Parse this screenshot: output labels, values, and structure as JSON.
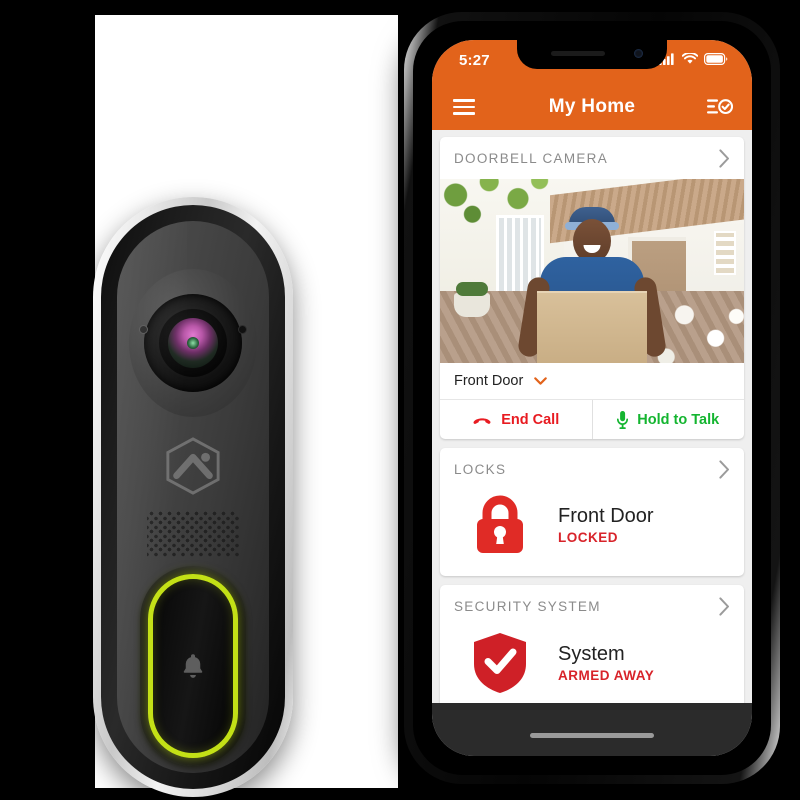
{
  "scene": {
    "background_color": "#000000",
    "panel_color": "#ffffff"
  },
  "doorbell_device": {
    "name": "video-doorbell",
    "brand_logo": "alarm-dot-com-hexagon-logo",
    "button_glyph": "bell-icon",
    "ring_light_color": "#c3e016",
    "body_color": "#3b3b3b",
    "trim_color": "#d8d8d8"
  },
  "phone": {
    "frame_color": "#0a0a0a",
    "status_bar": {
      "time": "5:27",
      "cellular_icon": "signal-bars-icon",
      "wifi_icon": "wifi-icon",
      "battery_icon": "battery-full-icon"
    },
    "nav_bar": {
      "menu_icon": "hamburger-menu-icon",
      "title": "My Home",
      "action_icon": "tasks-check-icon",
      "background_color": "#e2631b"
    },
    "home_indicator": "home-indicator-bar"
  },
  "app": {
    "cards": [
      {
        "id": "doorbell-camera",
        "header": "DOORBELL CAMERA",
        "chevron": "chevron-right-icon",
        "feed": {
          "alt": "Delivery person holding a cardboard box at a house front door",
          "camera_name": "Front Door",
          "camera_picker_icon": "chevron-down-icon",
          "picker_color": "#e2631b"
        },
        "actions": [
          {
            "id": "end-call",
            "label": "End Call",
            "icon": "phone-hangup-icon",
            "color": "#e81b21"
          },
          {
            "id": "hold-to-talk",
            "label": "Hold to Talk",
            "icon": "microphone-icon",
            "color": "#14b530"
          }
        ]
      },
      {
        "id": "locks",
        "header": "LOCKS",
        "chevron": "chevron-right-icon",
        "device": {
          "icon": "padlock-locked-icon",
          "icon_color": "#e02b26",
          "name": "Front Door",
          "state": "LOCKED",
          "state_color": "#d8232a"
        }
      },
      {
        "id": "security-system",
        "header": "SECURITY SYSTEM",
        "chevron": "chevron-right-icon",
        "device": {
          "icon": "shield-check-icon",
          "icon_color": "#cf2027",
          "name": "System",
          "state": "ARMED AWAY",
          "state_color": "#d8232a"
        }
      }
    ]
  }
}
